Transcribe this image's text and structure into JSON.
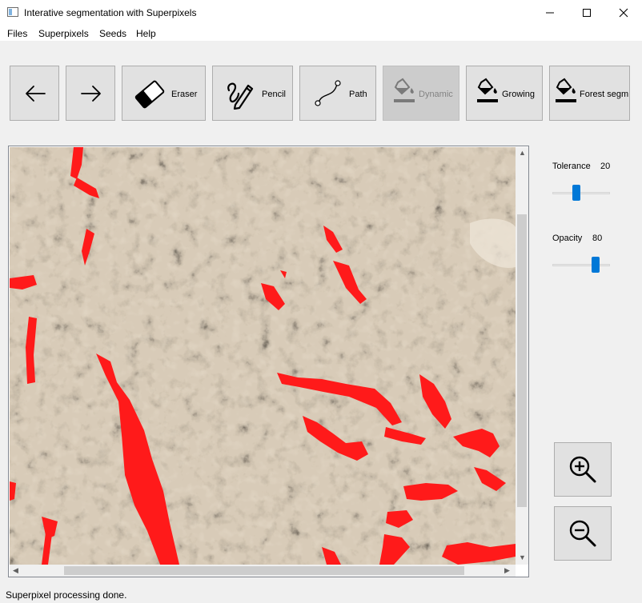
{
  "window": {
    "title": "Interative segmentation with Superpixels"
  },
  "menu": [
    "Files",
    "Superpixels",
    "Seeds",
    "Help"
  ],
  "toolbar": {
    "back": {
      "icon": "arrow-left-icon"
    },
    "forward": {
      "icon": "arrow-right-icon"
    },
    "eraser": {
      "label": "Eraser",
      "icon": "eraser-icon"
    },
    "pencil": {
      "label": "Pencil",
      "icon": "pencil-icon"
    },
    "path": {
      "label": "Path",
      "icon": "path-curve-icon"
    },
    "dynamic": {
      "label": "Dynamic",
      "icon": "paint-bucket-icon",
      "enabled": false
    },
    "growing": {
      "label": "Growing",
      "icon": "paint-bucket-icon"
    },
    "forest": {
      "label": "Forest segm",
      "icon": "paint-bucket-icon"
    }
  },
  "sliders": {
    "tolerance": {
      "label": "Tolerance",
      "value": "20"
    },
    "opacity": {
      "label": "Opacity",
      "value": "80"
    }
  },
  "zoom": {
    "in_icon": "zoom-in-icon",
    "out_icon": "zoom-out-icon"
  },
  "status": "Superpixel processing done.",
  "colors": {
    "seed": "#ff1a1a",
    "accent": "#0078d7",
    "button_bg": "#e1e1e1"
  }
}
